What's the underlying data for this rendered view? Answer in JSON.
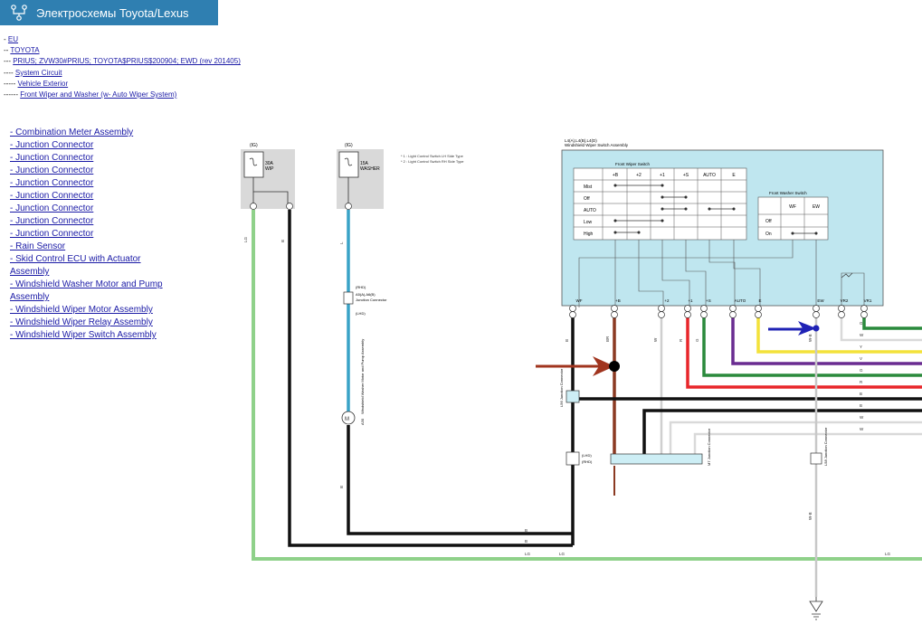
{
  "app": {
    "title": "Электросхемы Toyota/Lexus",
    "logo_icon": "circuit-icon",
    "brand_color": "#2f7fb1"
  },
  "breadcrumbs": [
    {
      "prefix": "- ",
      "label": "EU"
    },
    {
      "prefix": "-- ",
      "label": "TOYOTA"
    },
    {
      "prefix": "--- ",
      "label": "PRIUS; ZVW30#PRIUS; TOYOTA$PRIUS$200904; EWD (rev 201405)"
    },
    {
      "prefix": "---- ",
      "label": "System Circuit"
    },
    {
      "prefix": "----- ",
      "label": "Vehicle Exterior"
    },
    {
      "prefix": "------ ",
      "label": "Front Wiper and Washer (w- Auto Wiper System)"
    }
  ],
  "components": [
    "- Combination Meter Assembly",
    "- Junction Connector",
    "- Junction Connector",
    "- Junction Connector",
    "- Junction Connector",
    "- Junction Connector",
    "- Junction Connector",
    "- Junction Connector",
    "- Junction Connector",
    "- Rain Sensor",
    "- Skid Control ECU with Actuator Assembly",
    "- Windshield Washer Motor and Pump Assembly",
    "- Windshield Wiper Motor Assembly",
    "- Windshield Wiper Relay Assembly",
    "- Windshield Wiper Switch Assembly"
  ],
  "diagram": {
    "fuse1": {
      "tag": "(IG)",
      "rating": "30A",
      "name": "WIP"
    },
    "fuse2": {
      "tag": "(IG)",
      "rating": "15A",
      "name": "WASHER"
    },
    "notes": [
      "* 1 : Light Control Switch LH Side Type",
      "* 2 : Light Control Switch RH Side Type"
    ],
    "switch_assembly_code": "L4(A),L4(B),L4(D)",
    "switch_assembly_name": "Windshield Wiper Switch Assembly",
    "front_wiper_switch_title": "Front Wiper Switch",
    "front_wiper_columns": [
      "+B",
      "+2",
      "+1",
      "+S",
      "AUTO",
      "E"
    ],
    "front_wiper_rows": [
      "Mist",
      "Off",
      "AUTO",
      "Low",
      "High"
    ],
    "front_washer_switch_title": "Front Washer Switch",
    "front_washer_columns": [
      "WF",
      "EW"
    ],
    "front_washer_rows": [
      "Off",
      "On"
    ],
    "switch_terminals": [
      "WF",
      "+B",
      "+2",
      "+1",
      "+S",
      "AUTO",
      "E",
      "EW",
      "VR2",
      "VR1"
    ],
    "washer_motor_name": "Windshield Washer Motor and Pump Assembly",
    "washer_motor_code": "A30",
    "junction_a": "A5(A),A6(B)",
    "junction_a_name": "Junction Connector",
    "wire_labels": {
      "lg": "LG",
      "b": "B",
      "l": "L",
      "br": "BR",
      "w": "W",
      "r": "R",
      "g": "G",
      "y": "Y",
      "v": "V",
      "wb": "W-B"
    },
    "junction_l56": "L56 Junction Connector",
    "junction_m": "M7 Junction Connector",
    "junction_l58": "L58 Junction Connector",
    "connector_lhd": "(LHD)",
    "connector_rhd": "(RHD)"
  }
}
